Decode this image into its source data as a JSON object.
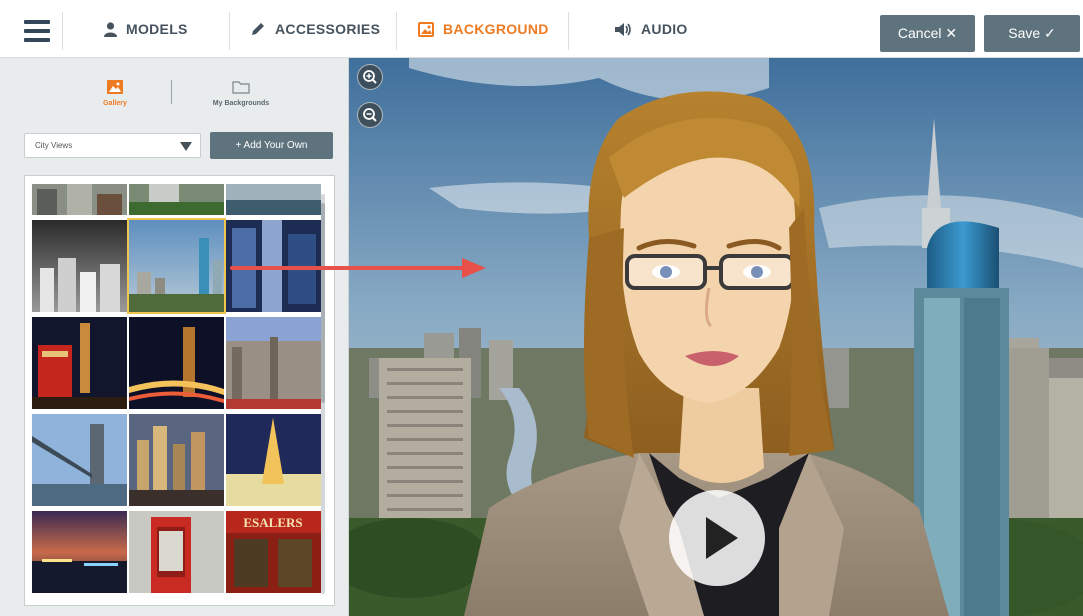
{
  "toolbar": {
    "menu_icon": "hamburger-menu-icon",
    "tabs": [
      {
        "label": "MODELS",
        "icon": "person-icon",
        "active": false
      },
      {
        "label": "ACCESSORIES",
        "icon": "pencil-icon",
        "active": false
      },
      {
        "label": "BACKGROUND",
        "icon": "image-icon",
        "active": true
      },
      {
        "label": "AUDIO",
        "icon": "speaker-icon",
        "active": false
      }
    ],
    "cancel_label": "Cancel ✕",
    "save_label": "Save ✓"
  },
  "left_panel": {
    "subtabs": [
      {
        "label": "Gallery",
        "icon": "image-icon",
        "active": true
      },
      {
        "label": "My Backgrounds",
        "icon": "folder-icon",
        "active": false
      }
    ],
    "category_select": {
      "value": "City Views"
    },
    "add_button_label": "+ Add Your Own",
    "gallery": {
      "thumbnails": [
        {
          "scene": "city-partial-1"
        },
        {
          "scene": "city-partial-2"
        },
        {
          "scene": "city-partial-3"
        },
        {
          "scene": "black-and-white-city"
        },
        {
          "scene": "jakarta-skyline",
          "selected": true
        },
        {
          "scene": "blue-city-aerial"
        },
        {
          "scene": "london-phone-box-big-ben"
        },
        {
          "scene": "london-night-traffic"
        },
        {
          "scene": "parliament-building"
        },
        {
          "scene": "tower-bridge"
        },
        {
          "scene": "city-night-lights"
        },
        {
          "scene": "eiffel-tower-night"
        },
        {
          "scene": "city-sunset-lights"
        },
        {
          "scene": "red-phone-box"
        },
        {
          "scene": "red-shop-front"
        }
      ],
      "shop_sign_text": "ESALERS"
    }
  },
  "stage": {
    "zoom_in_icon": "zoom-in-icon",
    "zoom_out_icon": "zoom-out-icon",
    "play_icon": "play-icon"
  },
  "colors": {
    "accent": "#ee7b22",
    "button": "#5e737d",
    "panel": "#e9eced",
    "arrow": "#e8514a",
    "text": "#46535e"
  }
}
